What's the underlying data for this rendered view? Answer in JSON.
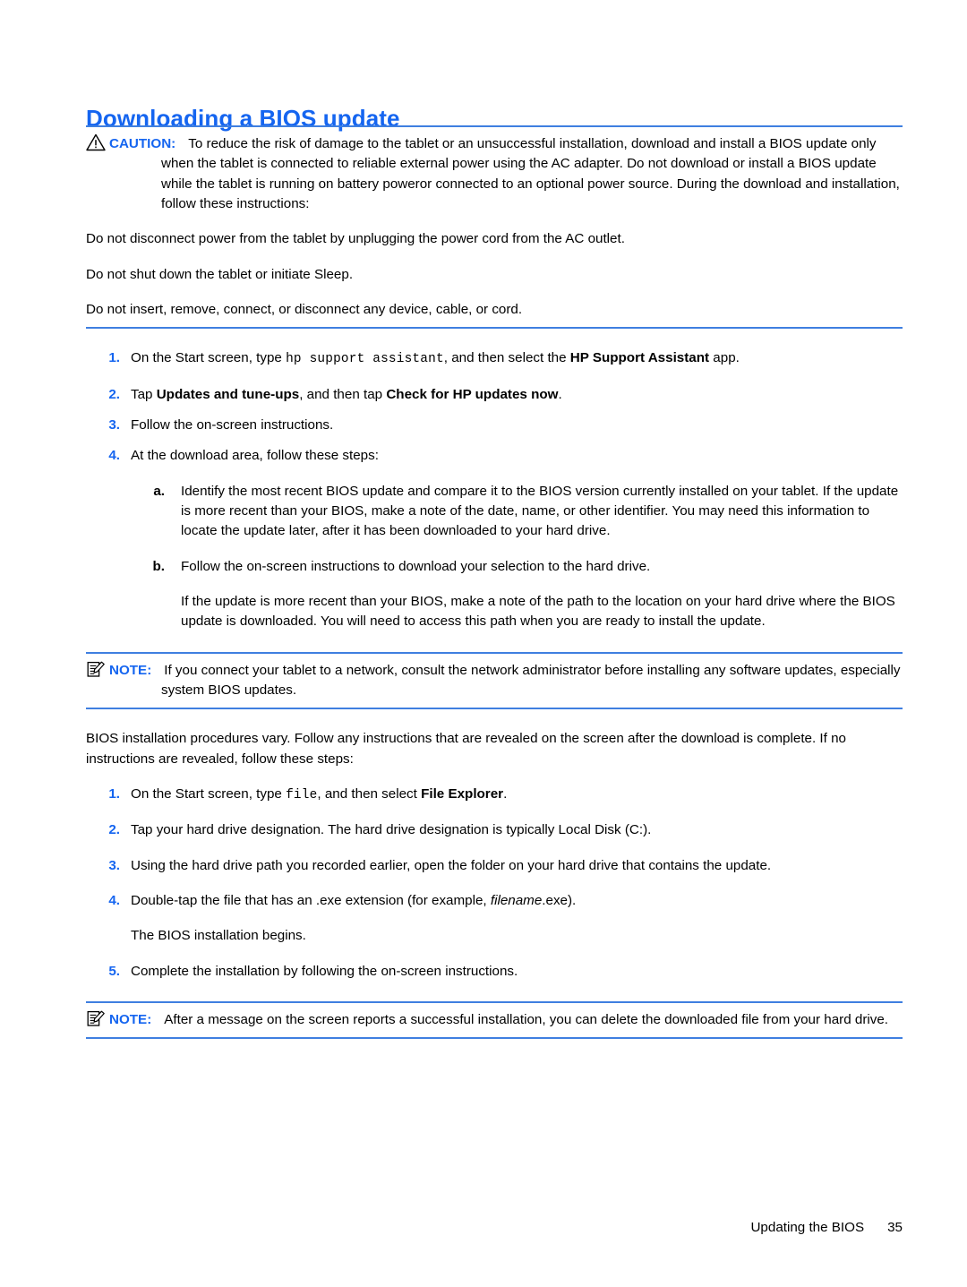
{
  "document": {
    "heading": "Downloading a BIOS update",
    "footer": {
      "section_label": "Updating the BIOS",
      "page_number": "35"
    },
    "colors": {
      "heading_blue": "#1565f0",
      "rule_blue": "#3f7fe0",
      "label_blue": "#1565f0",
      "body_black": "#000000"
    }
  },
  "caution": {
    "icon": "warning-triangle-icon",
    "label": "CAUTION:",
    "text": "To reduce the risk of damage to the tablet or an unsuccessful installation, download and install a BIOS update only when the tablet is connected to reliable external power using the AC adapter. Do not download or install a BIOS update while the tablet is running on battery poweror connected to an optional power source. During the download and installation, follow these instructions:",
    "bullets": [
      "Do not disconnect power from the tablet by unplugging the power cord from the AC outlet.",
      "Do not shut down the tablet or initiate Sleep.",
      "Do not insert, remove, connect, or disconnect any device, cable, or cord."
    ]
  },
  "steps_primary": {
    "item1": {
      "marker": "1.",
      "part1": "On the Start screen, type ",
      "mono": "hp support assistant",
      "part2": ", and then select the ",
      "bold1": "HP Support Assistant",
      "part3": " app."
    },
    "item2": {
      "marker": "2.",
      "part1": "Tap ",
      "bold1": "Updates and tune-ups",
      "part2": ", and then tap ",
      "bold2": "Check for HP updates now",
      "part3": "."
    },
    "item3": {
      "marker": "3.",
      "text": "Follow the on-screen instructions."
    },
    "item4": {
      "marker": "4.",
      "text": "At the download area, follow these steps:",
      "subitems": {
        "a": {
          "marker": "a.",
          "text": "Identify the most recent BIOS update and compare it to the BIOS version currently installed on your tablet. If the update is more recent than your BIOS, make a note of the date, name, or other identifier. You may need this information to locate the update later, after it has been downloaded to your hard drive."
        },
        "b": {
          "marker": "b.",
          "text": "Follow the on-screen instructions to download your selection to the hard drive.",
          "continuation": "If the update is more recent than your BIOS, make a note of the path to the location on your hard drive where the BIOS update is downloaded. You will need to access this path when you are ready to install the update."
        }
      }
    }
  },
  "note_network": {
    "icon": "note-pad-icon",
    "label": "NOTE:",
    "text": "If you connect your tablet to a network, consult the network administrator before installing any software updates, especially system BIOS updates."
  },
  "intro_install": "BIOS installation procedures vary. Follow any instructions that are revealed on the screen after the download is complete. If no instructions are revealed, follow these steps:",
  "steps_secondary": {
    "item1": {
      "marker": "1.",
      "part1": "On the Start screen, type ",
      "mono": "file",
      "part2": ", and then select ",
      "bold1": "File Explorer",
      "part3": "."
    },
    "item2": {
      "marker": "2.",
      "text": "Tap your hard drive designation. The hard drive designation is typically Local Disk (C:)."
    },
    "item3": {
      "marker": "3.",
      "text": "Using the hard drive path you recorded earlier, open the folder on your hard drive that contains the update."
    },
    "item4": {
      "marker": "4.",
      "part1": "Double-tap the file that has an .exe extension (for example, ",
      "italic1": "filename",
      "part2": ".exe).",
      "continuation": "The BIOS installation begins."
    },
    "item5": {
      "marker": "5.",
      "text": "Complete the installation by following the on-screen instructions."
    }
  },
  "note_delete": {
    "icon": "note-pad-icon",
    "label": "NOTE:",
    "text": "After a message on the screen reports a successful installation, you can delete the downloaded file from your hard drive."
  }
}
